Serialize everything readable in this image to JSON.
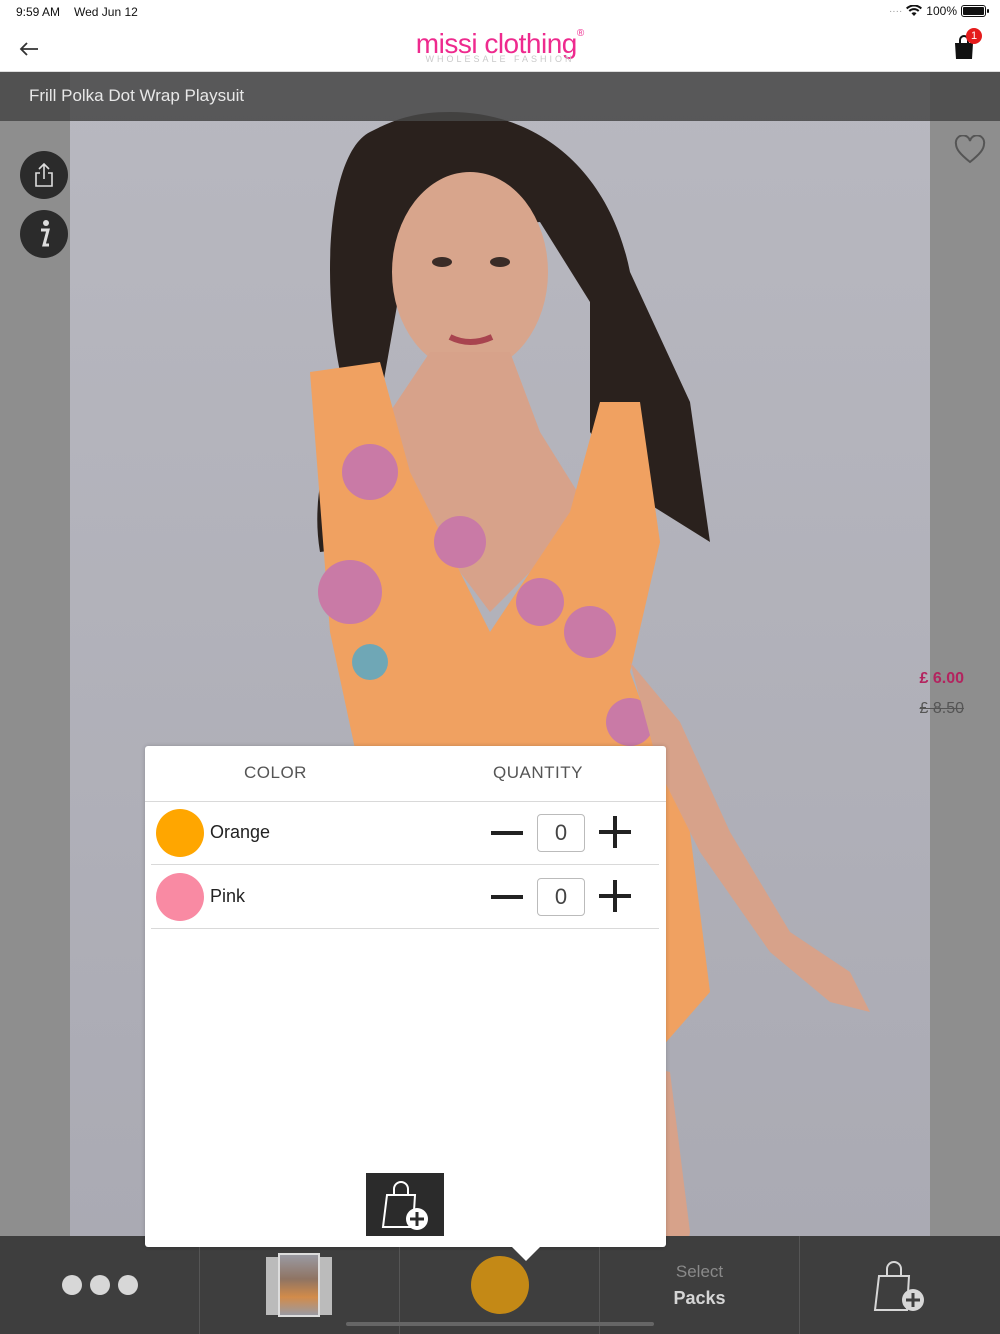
{
  "status_bar": {
    "time": "9:59 AM",
    "date": "Wed Jun 12",
    "battery": "100%"
  },
  "nav": {
    "logo_main": "missi clothing",
    "logo_reg": "®",
    "logo_sub": "WHOLESALE FASHION",
    "cart_count": "1"
  },
  "product": {
    "title": "Frill Polka Dot Wrap Playsuit",
    "price_now": "£ 6.00",
    "price_was": "£ 8.50"
  },
  "popup": {
    "header_color": "COLOR",
    "header_quantity": "QUANTITY",
    "colors": [
      {
        "name": "Orange",
        "swatch": "#ffa600",
        "quantity": "0"
      },
      {
        "name": "Pink",
        "swatch": "#f98aa3",
        "quantity": "0"
      }
    ]
  },
  "toolbar": {
    "selected_color_swatch": "#c48916",
    "packs_select": "Select",
    "packs_label": "Packs"
  },
  "colors": {
    "brand_pink": "#ee2a8e",
    "price_color": "#b3245f",
    "toolbar_bg": "#3e3e3e"
  }
}
